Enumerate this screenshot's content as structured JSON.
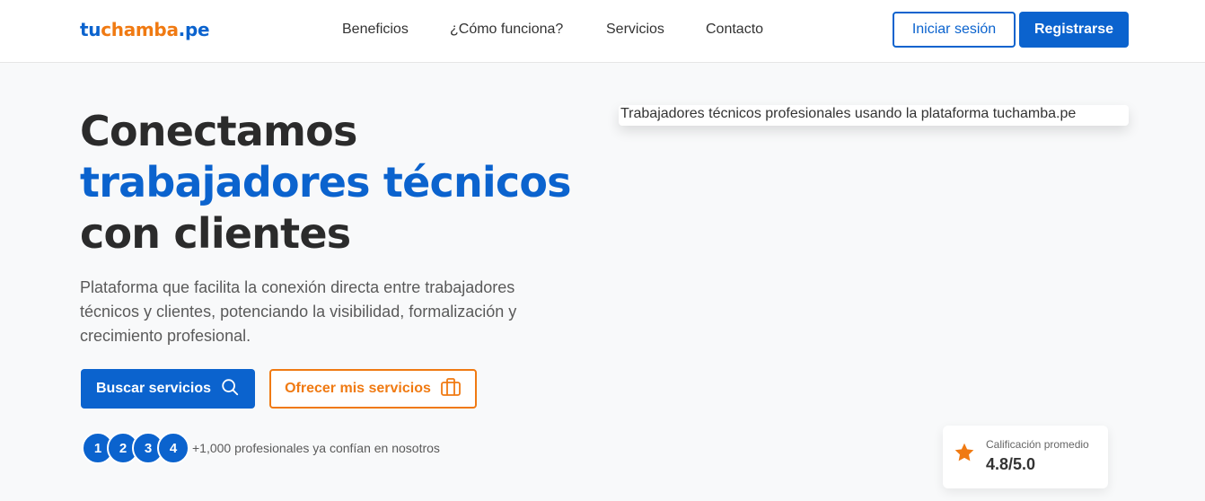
{
  "header": {
    "logo": {
      "part1": "tu",
      "part2": "chamba",
      "part3": ".pe"
    },
    "nav": [
      {
        "label": "Beneficios"
      },
      {
        "label": "¿Cómo funciona?"
      },
      {
        "label": "Servicios"
      },
      {
        "label": "Contacto"
      }
    ],
    "login_label": "Iniciar sesión",
    "register_label": "Registrarse"
  },
  "hero": {
    "title_line1": "Conectamos",
    "title_accent": "trabajadores técnicos",
    "title_line3": "con clientes",
    "description": "Plataforma que facilita la conexión directa entre trabajadores técnicos y clientes, potenciando la visibilidad, formalización y crecimiento profesional.",
    "search_button": "Buscar servicios",
    "offer_button": "Ofrecer mis servicios",
    "avatars": [
      "1",
      "2",
      "3",
      "4"
    ],
    "social_proof": "+1,000 profesionales ya confían en nosotros",
    "image_alt": "Trabajadores técnicos profesionales usando la plataforma tuchamba.pe"
  },
  "rating": {
    "label": "Calificación promedio",
    "value": "4.8/5.0"
  },
  "colors": {
    "brand_blue": "#0b63ce",
    "brand_orange": "#f07a12"
  },
  "icons": {
    "search": "search-icon",
    "briefcase": "briefcase-icon",
    "star": "star-icon"
  }
}
